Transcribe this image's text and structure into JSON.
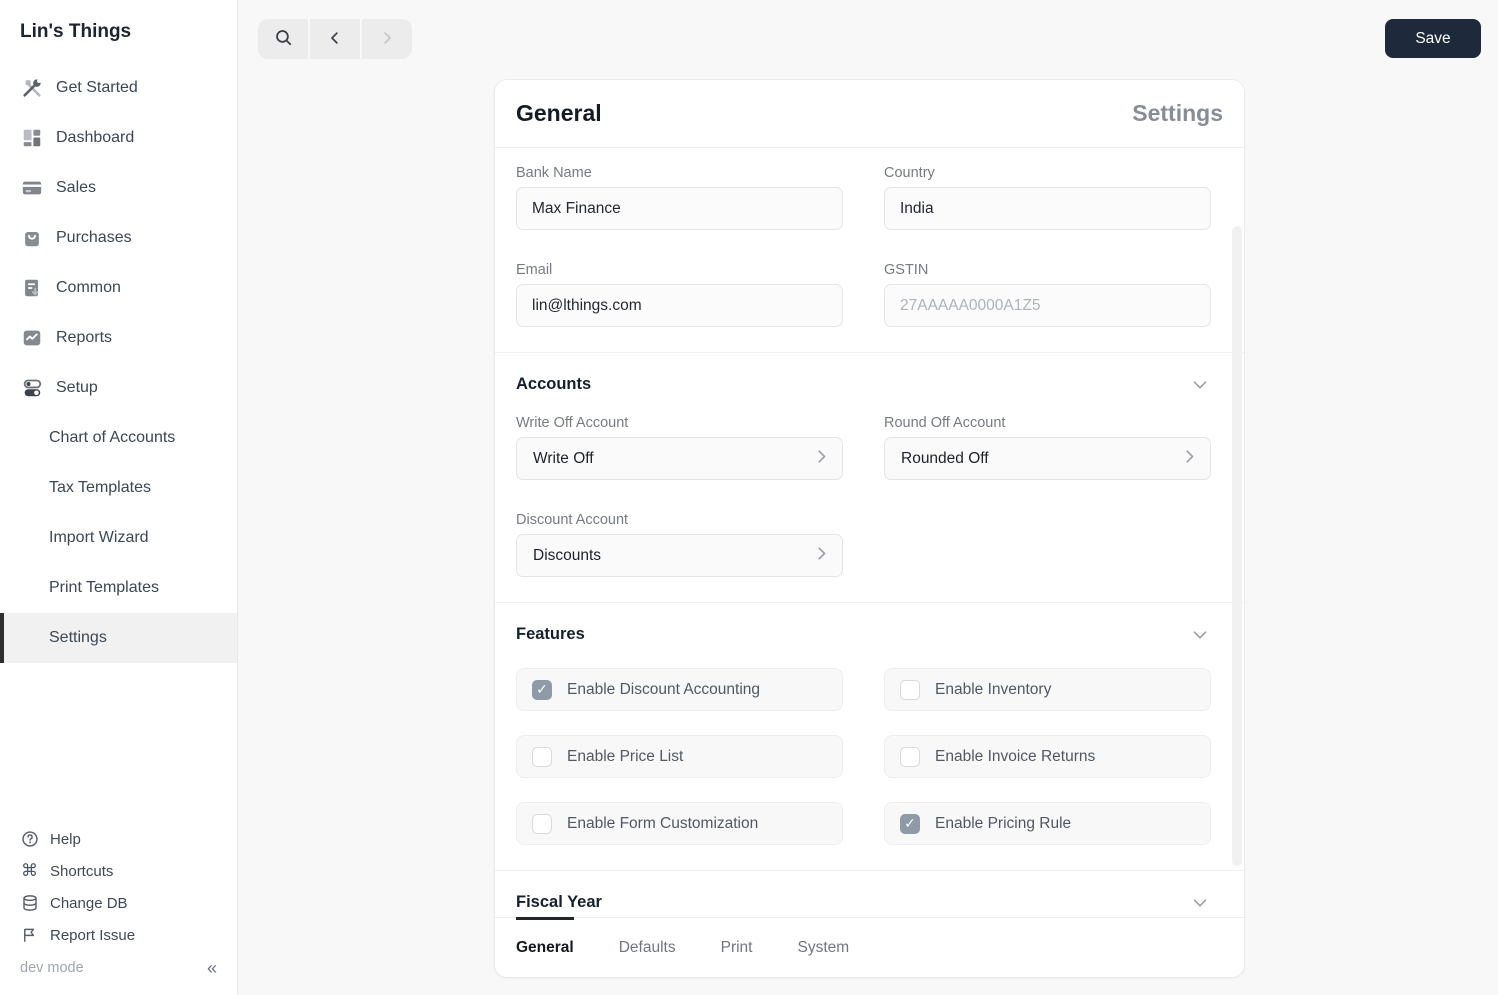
{
  "sidebar": {
    "title": "Lin's Things",
    "items": [
      {
        "label": "Get Started",
        "icon": "tools-icon"
      },
      {
        "label": "Dashboard",
        "icon": "dashboard-icon"
      },
      {
        "label": "Sales",
        "icon": "credit-card-icon"
      },
      {
        "label": "Purchases",
        "icon": "shopping-bag-icon"
      },
      {
        "label": "Common",
        "icon": "document-icon"
      },
      {
        "label": "Reports",
        "icon": "report-chart-icon"
      },
      {
        "label": "Setup",
        "icon": "toggles-icon"
      }
    ],
    "setup_children": [
      {
        "label": "Chart of Accounts",
        "active": false
      },
      {
        "label": "Tax Templates",
        "active": false
      },
      {
        "label": "Import Wizard",
        "active": false
      },
      {
        "label": "Print Templates",
        "active": false
      },
      {
        "label": "Settings",
        "active": true
      }
    ],
    "footer_items": [
      {
        "label": "Help",
        "icon": "help-icon"
      },
      {
        "label": "Shortcuts",
        "icon": "command-icon"
      },
      {
        "label": "Change DB",
        "icon": "database-icon"
      },
      {
        "label": "Report Issue",
        "icon": "flag-icon"
      }
    ],
    "dev_mode_label": "dev mode",
    "collapse_glyph": "«"
  },
  "toolbar": {
    "save_label": "Save"
  },
  "page": {
    "title": "General",
    "subtitle": "Settings",
    "fields": {
      "bank_name": {
        "label": "Bank Name",
        "value": "Max Finance"
      },
      "country": {
        "label": "Country",
        "value": "India"
      },
      "email": {
        "label": "Email",
        "value": "lin@lthings.com"
      },
      "gstin": {
        "label": "GSTIN",
        "value": "",
        "placeholder": "27AAAAA0000A1Z5"
      }
    },
    "sections": {
      "accounts": {
        "heading": "Accounts",
        "write_off_account": {
          "label": "Write Off Account",
          "value": "Write Off"
        },
        "round_off_account": {
          "label": "Round Off Account",
          "value": "Rounded Off"
        },
        "discount_account": {
          "label": "Discount Account",
          "value": "Discounts"
        }
      },
      "features": {
        "heading": "Features",
        "items": [
          {
            "label": "Enable Discount Accounting",
            "checked": true
          },
          {
            "label": "Enable Inventory",
            "checked": false
          },
          {
            "label": "Enable Price List",
            "checked": false
          },
          {
            "label": "Enable Invoice Returns",
            "checked": false
          },
          {
            "label": "Enable Form Customization",
            "checked": false
          },
          {
            "label": "Enable Pricing Rule",
            "checked": true
          }
        ]
      },
      "fiscal_year": {
        "heading": "Fiscal Year"
      }
    },
    "tabs": [
      {
        "label": "General",
        "active": true
      },
      {
        "label": "Defaults",
        "active": false
      },
      {
        "label": "Print",
        "active": false
      },
      {
        "label": "System",
        "active": false
      }
    ]
  },
  "colors": {
    "save_button": "#1e293b",
    "active_tab_underline": "#23272d",
    "checkbox_checked": "#8e9aa8",
    "sidebar_active_bar": "#2e2e2e",
    "background": "#f8f8f8"
  }
}
